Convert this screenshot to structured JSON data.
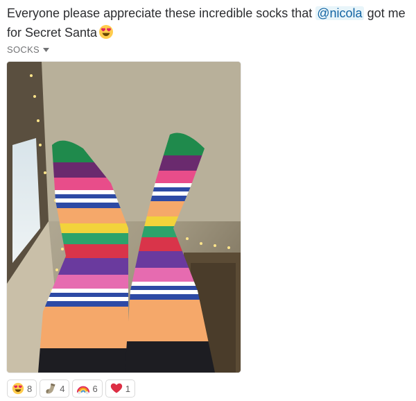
{
  "message": {
    "text_before": "Everyone please appreciate these incredible socks that ",
    "mention": "@nicola",
    "text_after": " got me for Secret Santa",
    "emoji": "heart-eyes-emoji"
  },
  "file": {
    "label": "SOCKS",
    "image": "photo-rainbow-striped-socks"
  },
  "reactions": [
    {
      "icon": "heart-eyes-emoji",
      "count": "8"
    },
    {
      "icon": "sock-emoji",
      "count": "4"
    },
    {
      "icon": "rainbow-emoji",
      "count": "6"
    },
    {
      "icon": "red-heart-emoji",
      "count": "1"
    }
  ],
  "colors": {
    "mention": "#1264a3",
    "mention_bg": "#e8f5fa",
    "sock_toe": "#1f8a4c",
    "stripe_orange": "#f5a86a"
  }
}
